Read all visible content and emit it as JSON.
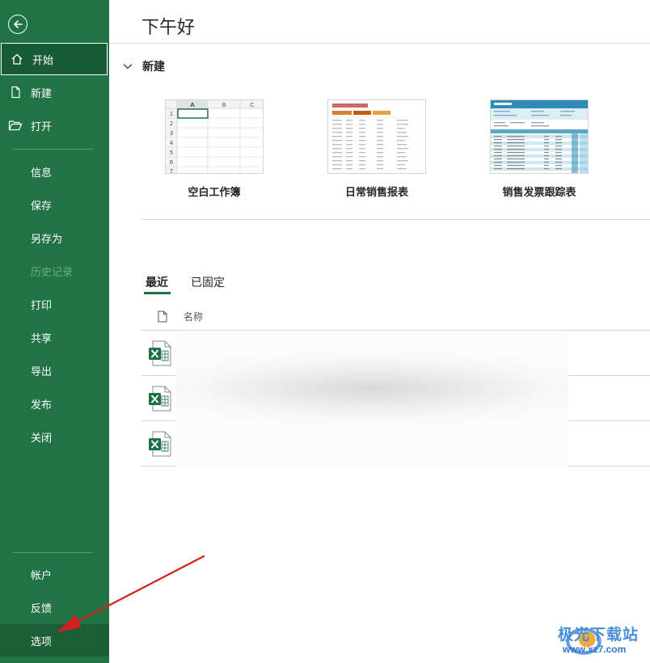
{
  "header": {
    "greeting": "下午好"
  },
  "sidebar": {
    "top_items": [
      {
        "label": "开始"
      },
      {
        "label": "新建"
      },
      {
        "label": "打开"
      }
    ],
    "mid_items": [
      {
        "label": "信息"
      },
      {
        "label": "保存"
      },
      {
        "label": "另存为"
      },
      {
        "label": "历史记录"
      },
      {
        "label": "打印"
      },
      {
        "label": "共享"
      },
      {
        "label": "导出"
      },
      {
        "label": "发布"
      },
      {
        "label": "关闭"
      }
    ],
    "bottom_items": [
      {
        "label": "帐户"
      },
      {
        "label": "反馈"
      },
      {
        "label": "选项"
      }
    ]
  },
  "new_section": {
    "title": "新建",
    "templates": [
      {
        "label": "空白工作簿"
      },
      {
        "label": "日常销售报表"
      },
      {
        "label": "销售发票跟踪表"
      }
    ],
    "blank_grid": {
      "columns": [
        "A",
        "B",
        "C"
      ],
      "rows": [
        "1",
        "2",
        "3",
        "4",
        "5",
        "6",
        "7"
      ]
    }
  },
  "recent": {
    "tabs": [
      {
        "label": "最近"
      },
      {
        "label": "已固定"
      }
    ],
    "column_name": "名称"
  },
  "watermark": {
    "text": "极光下载站",
    "url": "www.xz7.com"
  },
  "colors": {
    "brand": "#217346",
    "active": "#185c37",
    "sales_orange": "#d9822b",
    "invoice_blue": "#2e8bb5"
  }
}
